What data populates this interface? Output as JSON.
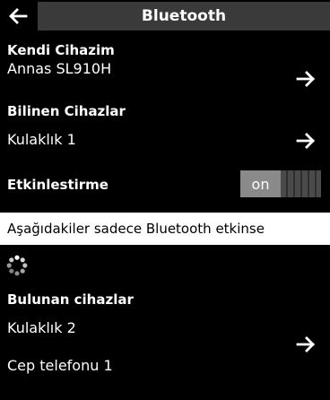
{
  "header": {
    "title": "Bluetooth"
  },
  "own_device": {
    "label": "Kendi Cihazim",
    "value": "Annas SL910H"
  },
  "known_devices": {
    "label": "Bilinen Cihazlar",
    "items": [
      "Kulaklık 1"
    ]
  },
  "activation": {
    "label": "Etkinlestirme",
    "state": "on"
  },
  "notice": "Aşağıdakiler sadece Bluetooth etkinse",
  "found_devices": {
    "label": "Bulunan cihazlar",
    "items": [
      "Kulaklık 2",
      "Cep telefonu 1"
    ]
  },
  "colors": {
    "background": "#000000",
    "title_bar": "#3a3a3a",
    "toggle_on": "#8a8a8a",
    "notice_bg": "#ffffff"
  },
  "icons": {
    "back": "left-arrow-icon",
    "forward": "right-arrow-icon",
    "busy": "spinner-icon"
  }
}
